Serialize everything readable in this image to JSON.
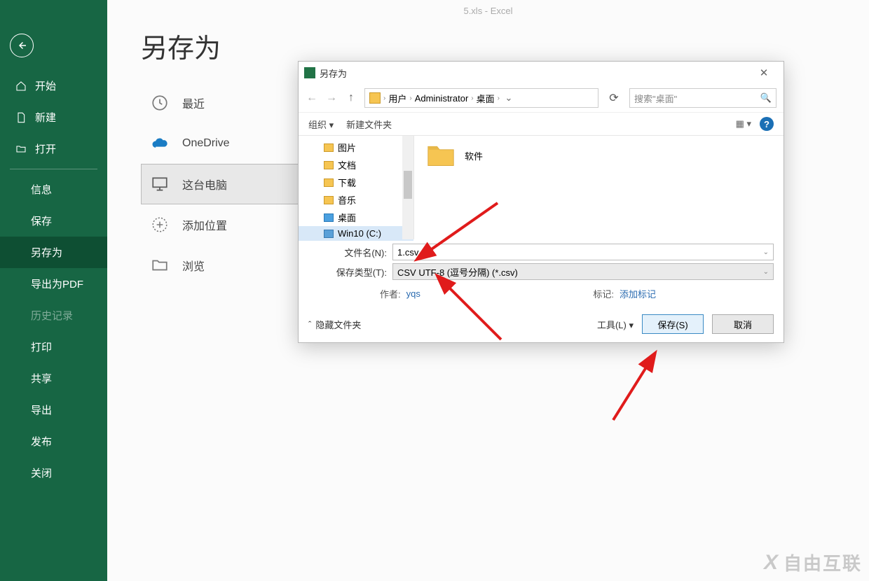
{
  "app": {
    "titlebar": "5.xls  -  Excel"
  },
  "page": {
    "title": "另存为"
  },
  "sidebar": {
    "items": [
      {
        "label": "开始"
      },
      {
        "label": "新建"
      },
      {
        "label": "打开"
      },
      {
        "label": "信息"
      },
      {
        "label": "保存"
      },
      {
        "label": "另存为"
      },
      {
        "label": "导出为PDF"
      },
      {
        "label": "历史记录"
      },
      {
        "label": "打印"
      },
      {
        "label": "共享"
      },
      {
        "label": "导出"
      },
      {
        "label": "发布"
      },
      {
        "label": "关闭"
      }
    ]
  },
  "locations": {
    "items": [
      {
        "label": "最近"
      },
      {
        "label": "OneDrive"
      },
      {
        "label": "这台电脑"
      },
      {
        "label": "添加位置"
      },
      {
        "label": "浏览"
      }
    ]
  },
  "dialog": {
    "title": "另存为",
    "breadcrumb": {
      "seg1": "用户",
      "seg2": "Administrator",
      "seg3": "桌面"
    },
    "search_placeholder": "搜索\"桌面\"",
    "toolbar": {
      "organize": "组织 ▾",
      "newfolder": "新建文件夹"
    },
    "tree": {
      "items": [
        {
          "label": "图片"
        },
        {
          "label": "文档"
        },
        {
          "label": "下载"
        },
        {
          "label": "音乐"
        },
        {
          "label": "桌面"
        },
        {
          "label": "Win10 (C:)"
        }
      ]
    },
    "files": {
      "item0": "软件"
    },
    "form": {
      "filename_label": "文件名(N):",
      "filename_value": "1.csv",
      "filetype_label": "保存类型(T):",
      "filetype_value": "CSV UTF-8 (逗号分隔) (*.csv)",
      "author_label": "作者:",
      "author_value": "yqs",
      "tags_label": "标记:",
      "tags_value": "添加标记"
    },
    "footer": {
      "hide_folders": "隐藏文件夹",
      "tools": "工具(L)  ▾",
      "save": "保存(S)",
      "cancel": "取消"
    }
  },
  "watermark": "自由互联"
}
